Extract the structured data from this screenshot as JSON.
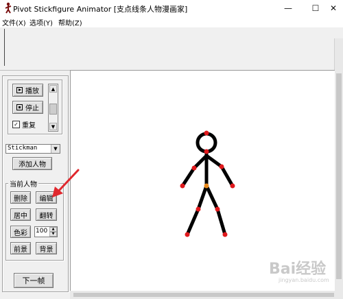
{
  "window": {
    "title": "Pivot Stickfigure Animator [支点线条人物漫画家]",
    "minimize": "—",
    "maximize": "☐",
    "close": "✕"
  },
  "menu": [
    "文件(X)",
    "选项(Y)",
    "帮助(Z)"
  ],
  "playback": {
    "play_label": "播放",
    "stop_label": "停止",
    "repeat_checked": true,
    "repeat_label": "重复"
  },
  "figure_select": {
    "value": "Stickman",
    "add_label": "添加人物"
  },
  "current_figure": {
    "group_label": "当前人物",
    "delete_label": "删除",
    "edit_label": "编辑",
    "center_label": "居中",
    "flip_label": "翻转",
    "color_label": "色彩",
    "alpha_value": "100",
    "front_label": "前景",
    "back_label": "背景"
  },
  "next_frame_label": "下一帧",
  "watermark": {
    "text": "Bai经验",
    "url": "jingyan.baidu.com"
  },
  "colors": {
    "joint": "#e0191c",
    "center_joint": "#e8891c",
    "annotation_arrow": "#e0282e"
  }
}
